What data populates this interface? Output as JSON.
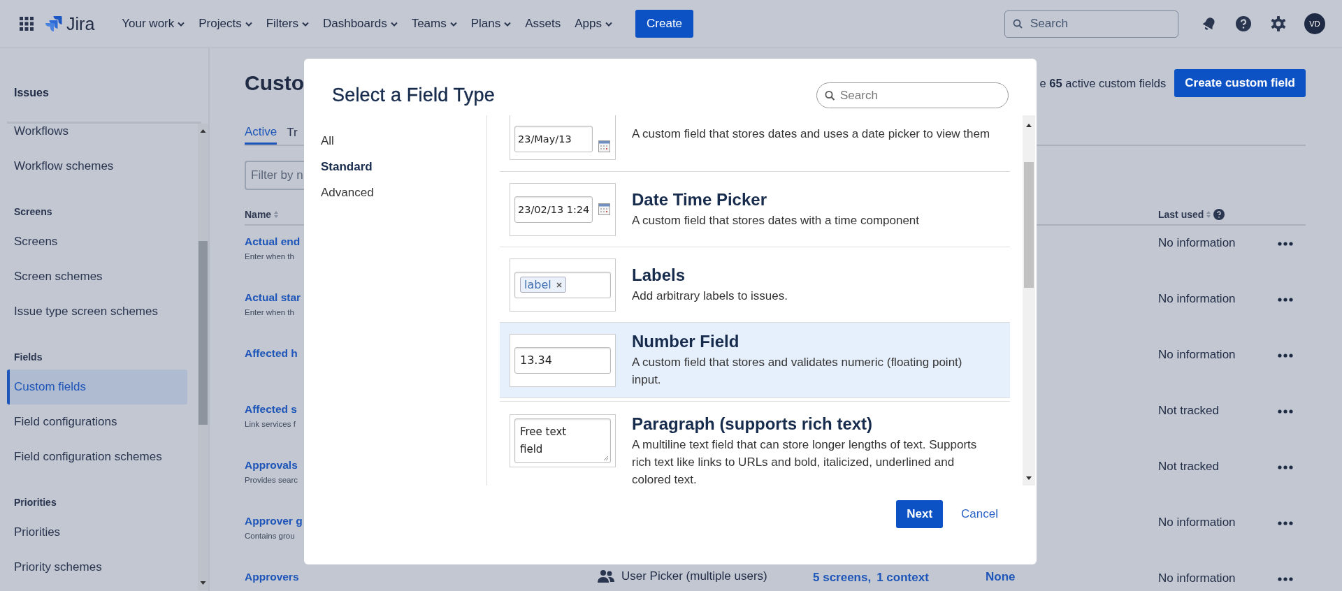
{
  "top_nav": {
    "product": "Jira",
    "items": [
      {
        "label": "Your work",
        "dropdown": true
      },
      {
        "label": "Projects",
        "dropdown": true
      },
      {
        "label": "Filters",
        "dropdown": true
      },
      {
        "label": "Dashboards",
        "dropdown": true
      },
      {
        "label": "Teams",
        "dropdown": true
      },
      {
        "label": "Plans",
        "dropdown": true
      },
      {
        "label": "Assets",
        "dropdown": false
      },
      {
        "label": "Apps",
        "dropdown": true
      }
    ],
    "create_button": "Create",
    "search": {
      "placeholder": "Search"
    },
    "avatar": "VD"
  },
  "sidebar": {
    "title": "Issues",
    "items": [
      {
        "kind": "link",
        "label": "Workflows",
        "selected": false
      },
      {
        "kind": "link",
        "label": "Workflow schemes",
        "selected": false
      },
      {
        "kind": "heading",
        "label": "Screens"
      },
      {
        "kind": "link",
        "label": "Screens",
        "selected": false
      },
      {
        "kind": "link",
        "label": "Screen schemes",
        "selected": false
      },
      {
        "kind": "link",
        "label": "Issue type screen schemes",
        "selected": false
      },
      {
        "kind": "heading",
        "label": "Fields"
      },
      {
        "kind": "link",
        "label": "Custom fields",
        "selected": true
      },
      {
        "kind": "link",
        "label": "Field configurations",
        "selected": false
      },
      {
        "kind": "link",
        "label": "Field configuration schemes",
        "selected": false
      },
      {
        "kind": "heading",
        "label": "Priorities"
      },
      {
        "kind": "link",
        "label": "Priorities",
        "selected": false
      },
      {
        "kind": "link",
        "label": "Priority schemes",
        "selected": false
      }
    ]
  },
  "page": {
    "title": "Custo",
    "summary": "e **65** active custom fields",
    "create_button": "Create custom field",
    "tabs": [
      {
        "label": "Active",
        "selected": true
      },
      {
        "label": "Tr",
        "selected": false
      }
    ],
    "filter": {
      "placeholder": "Filter by n"
    },
    "columns": {
      "name": "Name",
      "last_used": "Last used"
    },
    "rows": [
      {
        "name": "Actual end",
        "description": "Enter when th",
        "last_used": "No information"
      },
      {
        "name": "Actual star",
        "description": "Enter when th",
        "last_used": "No information"
      },
      {
        "name": "Affected h",
        "last_used": "No information"
      },
      {
        "name": "Affected s",
        "description": "Link services f",
        "last_used": "Not tracked"
      },
      {
        "name": "Approvals",
        "description": "Provides searc",
        "last_used": "Not tracked"
      },
      {
        "name": "Approver g",
        "description": "Contains grou",
        "last_used": "No information"
      },
      {
        "name": "Approvers",
        "type": "User Picker (multiple users)",
        "screens": "5 screens,",
        "contexts": "1 context",
        "column_4": "None",
        "last_used": "No information"
      }
    ]
  },
  "modal": {
    "title": "Select a Field Type",
    "search": {
      "placeholder": "Search"
    },
    "categories": [
      {
        "label": "All",
        "selected": false
      },
      {
        "label": "Standard",
        "selected": true
      },
      {
        "label": "Advanced",
        "selected": false
      }
    ],
    "field_types": [
      {
        "kind": "date",
        "preview": "23/May/13",
        "description": "A custom field that stores dates and uses a date picker to view them",
        "selected": false
      },
      {
        "kind": "date",
        "title": "Date Time Picker",
        "preview": "23/02/13 1:24",
        "description": "A custom field that stores dates with a time component",
        "selected": false
      },
      {
        "kind": "labels",
        "title": "Labels",
        "preview": "label",
        "description": "Add arbitrary labels to issues.",
        "selected": false
      },
      {
        "kind": "text",
        "title": "Number Field",
        "preview": "13.34",
        "description": "A custom field that stores and validates numeric (floating point) input.",
        "selected": true
      },
      {
        "kind": "textarea",
        "title": "Paragraph (supports rich text)",
        "preview": "Free text field",
        "description": "A multiline text field that can store longer lengths of text. Supports rich text like links to URLs and bold, italicized, underlined and colored text.",
        "selected": false
      }
    ],
    "buttons": {
      "next": "Next",
      "cancel": "Cancel"
    }
  }
}
